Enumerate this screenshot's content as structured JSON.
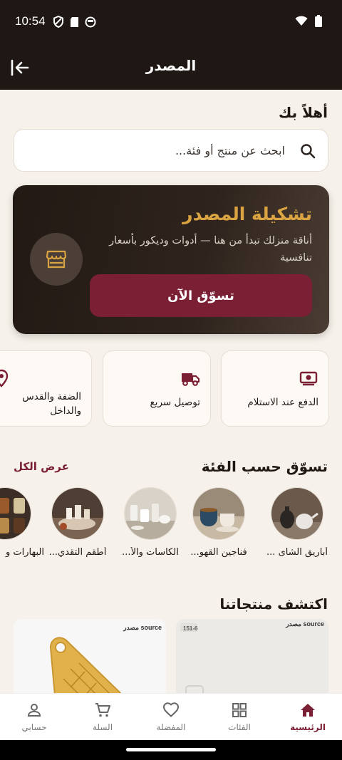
{
  "status": {
    "time": "10:54"
  },
  "appbar": {
    "title": "المصدر"
  },
  "greeting": "أهلاً بك",
  "search": {
    "placeholder": "ابحث عن منتج أو فئة..."
  },
  "promo": {
    "title": "تشكيلة المصدر",
    "subtitle": "أناقة منزلك تبدأ من هنا — أدوات وديكور بأسعار تنافسية",
    "button": "تسوّق الآن"
  },
  "features": [
    {
      "label": "الدفع عند الاستلام",
      "icon": "cash-icon"
    },
    {
      "label": "توصيل سريع",
      "icon": "truck-icon"
    },
    {
      "label": "الضفة والقدس\nوالداخل",
      "icon": "location-pin-icon"
    }
  ],
  "categories": {
    "title": "تسوّق حسب الفئة",
    "view_all": "عرض الكل",
    "items": [
      {
        "label": "أباريق الشاى ..."
      },
      {
        "label": "فناجين القهو..."
      },
      {
        "label": "الكاسات والأ..."
      },
      {
        "label": "أطقم التقدي..."
      },
      {
        "label": "البهارات و"
      }
    ]
  },
  "products": {
    "title": "اكتشف منتجاتنا",
    "items": [
      {
        "brand": "مصدر source",
        "code": "151-6"
      },
      {
        "brand": "مصدر source"
      }
    ]
  },
  "bottom_nav": [
    {
      "label": "الرئيسية",
      "icon": "home-icon",
      "active": true
    },
    {
      "label": "الفئات",
      "icon": "grid-icon"
    },
    {
      "label": "المفضلة",
      "icon": "heart-icon"
    },
    {
      "label": "السلة",
      "icon": "cart-icon"
    },
    {
      "label": "حسابي",
      "icon": "person-icon"
    }
  ],
  "colors": {
    "accent": "#7a1f34",
    "gold": "#d9a441",
    "dark": "#1f1713",
    "background": "#f6f1ea"
  }
}
